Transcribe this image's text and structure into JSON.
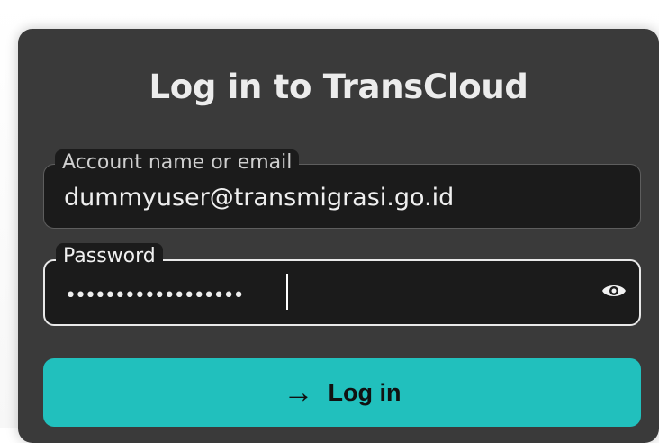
{
  "login": {
    "title": "Log in to TransCloud",
    "account_field": {
      "label": "Account name or email",
      "value": "dummyuser@transmigrasi.go.id"
    },
    "password_field": {
      "label": "Password",
      "value": "••••••••••••••••••"
    },
    "submit": {
      "icon": "arrow-right-icon",
      "arrow": "→",
      "label": "Log in"
    },
    "show_password_icon": "eye-icon"
  },
  "colors": {
    "card_background": "#3a3a3a",
    "field_background": "#1b1b1b",
    "accent": "#21c0bd",
    "text": "#efefef"
  }
}
